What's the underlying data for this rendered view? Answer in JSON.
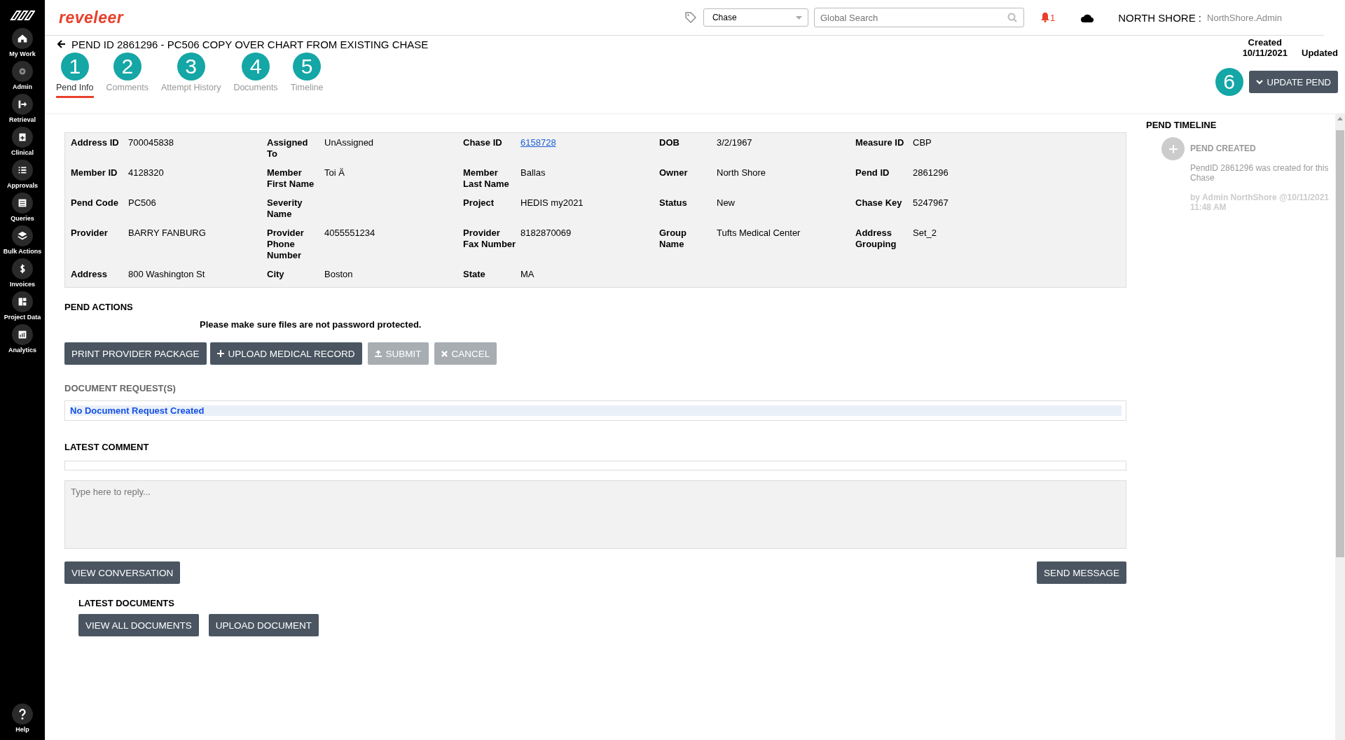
{
  "sidebar": {
    "items": [
      {
        "label": "My Work"
      },
      {
        "label": "Admin"
      },
      {
        "label": "Retrieval"
      },
      {
        "label": "Clinical"
      },
      {
        "label": "Approvals"
      },
      {
        "label": "Queries"
      },
      {
        "label": "Bulk Actions"
      },
      {
        "label": "Invoices"
      },
      {
        "label": "Project Data"
      },
      {
        "label": "Analytics"
      }
    ],
    "help": {
      "label": "Help"
    }
  },
  "topbar": {
    "logo": "reveleer",
    "type_select": {
      "value": "Chase"
    },
    "search": {
      "placeholder": "Global Search"
    },
    "notifications": "1",
    "org": "NORTH SHORE :",
    "user": "NorthShore.Admin"
  },
  "header": {
    "title": "PEND ID 2861296 - PC506 COPY OVER CHART FROM EXISTING CHASE",
    "created_label": "Created",
    "created_date": "10/11/2021",
    "updated_label": "Updated",
    "update_button": {
      "label": "UPDATE PEND",
      "callout": "6"
    }
  },
  "tabs": [
    {
      "label": "Pend Info",
      "selected": true,
      "callout": "1"
    },
    {
      "label": "Comments",
      "selected": false,
      "callout": "2"
    },
    {
      "label": "Attempt History",
      "selected": false,
      "callout": "3"
    },
    {
      "label": "Documents",
      "selected": false,
      "callout": "4"
    },
    {
      "label": "Timeline",
      "selected": false,
      "callout": "5"
    }
  ],
  "info": {
    "rows": [
      [
        {
          "label": "Address ID",
          "value": "700045838"
        },
        {
          "label": "Assigned To",
          "value": "UnAssigned"
        },
        {
          "label": "Chase ID",
          "value": "6158728",
          "kind": "link"
        },
        {
          "label": "DOB",
          "value": "3/2/1967"
        },
        {
          "label": "Measure ID",
          "value": "CBP"
        }
      ],
      [
        {
          "label": "Member ID",
          "value": "4128320"
        },
        {
          "label": "Member First Name",
          "value": "Toi Ä"
        },
        {
          "label": "Member Last Name",
          "value": "Ballas"
        },
        {
          "label": "Owner",
          "value": "North Shore"
        },
        {
          "label": "Pend ID",
          "value": "2861296"
        }
      ],
      [
        {
          "label": "Pend Code",
          "value": "PC506"
        },
        {
          "label": "Severity Name"
        },
        {
          "label": "Project",
          "value": "HEDIS my2021"
        },
        {
          "label": "Status",
          "value": "New"
        },
        {
          "label": "Chase Key",
          "value": "5247967"
        }
      ],
      [
        {
          "label": "Provider",
          "value": "BARRY FANBURG"
        },
        {
          "label": "Provider Phone Number",
          "value": "4055551234"
        },
        {
          "label": "Provider Fax Number",
          "value": "8182870069"
        },
        {
          "label": "Group Name",
          "value": "Tufts Medical Center"
        },
        {
          "label": "Address Grouping",
          "value": "Set_2"
        }
      ],
      [
        {
          "label": "Address",
          "value": "800 Washington St"
        },
        {
          "label": "City",
          "value": "Boston"
        },
        {
          "label": "State",
          "value": "MA"
        }
      ]
    ]
  },
  "pend_actions": {
    "title": "PEND ACTIONS",
    "notice": "Please make sure files are not password protected.",
    "buttons": [
      {
        "label": "PRINT PROVIDER PACKAGE",
        "kind": "plain",
        "disabled": false
      },
      {
        "label": "UPLOAD MEDICAL RECORD",
        "kind": "plus",
        "disabled": false
      },
      {
        "label": "SUBMIT",
        "kind": "upload",
        "disabled": true
      },
      {
        "label": "CANCEL",
        "kind": "close",
        "disabled": true
      }
    ]
  },
  "document_requests": {
    "title": "DOCUMENT REQUEST(S)",
    "items": [
      "No Document Request Created"
    ]
  },
  "latest_comment": {
    "title": "LATEST COMMENT",
    "reply": {
      "placeholder": "Type here to reply..."
    },
    "view_button": "VIEW CONVERSATION",
    "send_button": "SEND MESSAGE"
  },
  "latest_documents": {
    "title": "LATEST DOCUMENTS",
    "buttons": [
      "VIEW ALL DOCUMENTS",
      "UPLOAD DOCUMENT"
    ]
  },
  "timeline": {
    "title": "PEND TIMELINE",
    "events": [
      {
        "title": "PEND CREATED",
        "text": "PendID 2861296 was created for this Chase",
        "by": "by Admin NorthShore @10/11/2021 11:48 AM"
      }
    ]
  }
}
